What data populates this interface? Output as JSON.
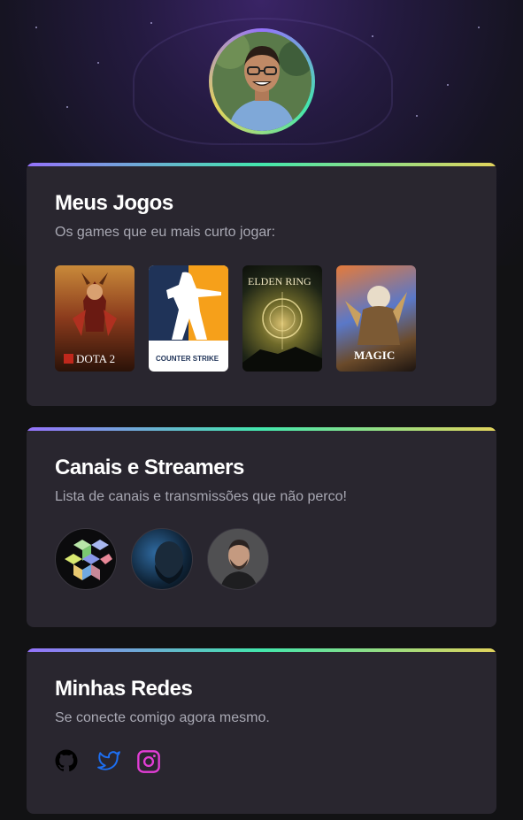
{
  "profile": {
    "avatar_icon": "profile-photo"
  },
  "sections": {
    "games": {
      "title": "Meus Jogos",
      "subtitle": "Os games que eu mais curto jogar:",
      "items": [
        {
          "name": "DOTA 2",
          "label": "DOTA 2"
        },
        {
          "name": "Counter Strike",
          "label": "COUNTER STRIKE"
        },
        {
          "name": "Elden Ring",
          "label": "ELDEN RING"
        },
        {
          "name": "Magic",
          "label": "MAGIC"
        }
      ]
    },
    "streamers": {
      "title": "Canais e Streamers",
      "subtitle": "Lista de canais e transmissões que não perco!"
    },
    "socials": {
      "title": "Minhas Redes",
      "subtitle": "Se conecte comigo agora mesmo.",
      "items": [
        {
          "icon": "github-icon",
          "color": "#000000"
        },
        {
          "icon": "twitter-icon",
          "color": "#1d6ff2"
        },
        {
          "icon": "instagram-icon",
          "color": "#e23dd6"
        }
      ]
    }
  },
  "colors": {
    "gradient_start": "#9572fc",
    "gradient_mid": "#43e7ad",
    "gradient_end": "#e2d45c",
    "card_bg": "#29262f",
    "page_bg": "#121214"
  }
}
